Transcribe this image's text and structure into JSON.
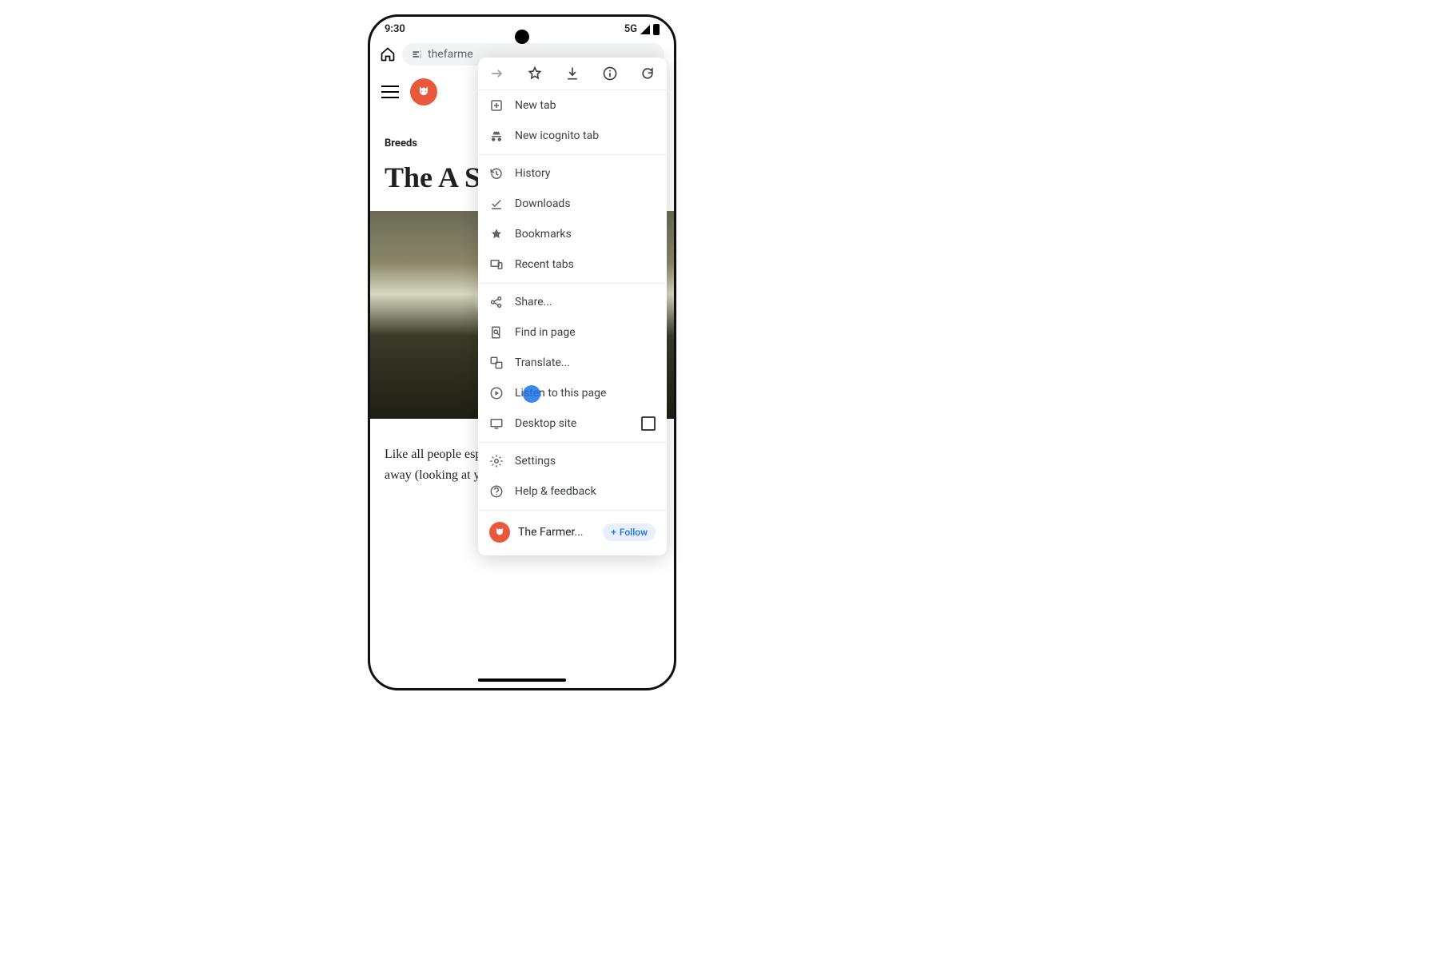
{
  "status": {
    "time": "9:30",
    "network": "5G"
  },
  "toolbar": {
    "url_text": "thefarme"
  },
  "article": {
    "section_tag": "Breeds",
    "headline_visible": "The A Sheph",
    "body_visible": "Like all people especially wh levels. Some a the day away (looking at you, pugs)."
  },
  "menu": {
    "items": {
      "new_tab": "New tab",
      "incognito": "New icognito tab",
      "history": "History",
      "downloads": "Downloads",
      "bookmarks": "Bookmarks",
      "recent_tabs": "Recent tabs",
      "share": "Share...",
      "find": "Find in page",
      "translate": "Translate...",
      "listen": "Listen to this page",
      "desktop": "Desktop site",
      "settings": "Settings",
      "help": "Help & feedback"
    },
    "site": {
      "name": "The Farmer...",
      "follow_label": "Follow"
    }
  }
}
